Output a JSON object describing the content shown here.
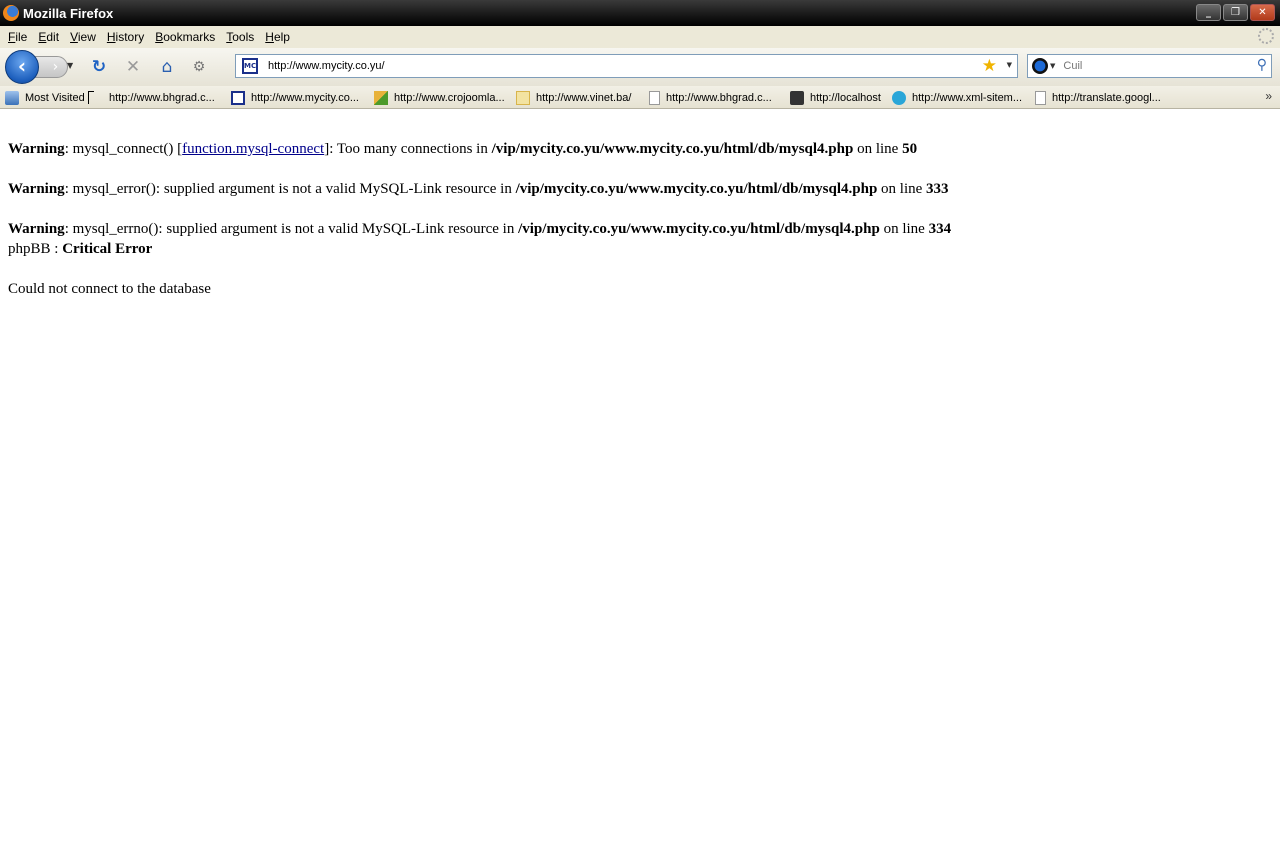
{
  "window": {
    "title": "Mozilla Firefox",
    "buttons": {
      "minimize": "_",
      "restore": "❐",
      "close": "✕"
    }
  },
  "menubar": {
    "items": [
      {
        "label": "File",
        "key": "F",
        "rest": "ile"
      },
      {
        "label": "Edit",
        "key": "E",
        "rest": "dit"
      },
      {
        "label": "View",
        "key": "V",
        "rest": "iew"
      },
      {
        "label": "History",
        "key": "H",
        "rest": "istory"
      },
      {
        "label": "Bookmarks",
        "key": "B",
        "rest": "ookmarks"
      },
      {
        "label": "Tools",
        "key": "T",
        "rest": "ools"
      },
      {
        "label": "Help",
        "key": "H",
        "rest": "elp"
      }
    ]
  },
  "navbar": {
    "url": "http://www.mycity.co.yu/",
    "site_icon_text": "MC",
    "search_placeholder": "Cuil"
  },
  "bookmarks": {
    "items": [
      {
        "label": "Most Visited",
        "icon": "most-visited-icon"
      },
      {
        "label": "http://www.bhgrad.c...",
        "icon": "page-icon"
      },
      {
        "label": "http://www.mycity.co...",
        "icon": "mycity-icon"
      },
      {
        "label": "http://www.crojoomla...",
        "icon": "crojoomla-icon"
      },
      {
        "label": "http://www.vinet.ba/",
        "icon": "vinet-icon"
      },
      {
        "label": "http://www.bhgrad.c...",
        "icon": "page-icon"
      },
      {
        "label": "http://localhost",
        "icon": "localhost-icon"
      },
      {
        "label": "http://www.xml-sitem...",
        "icon": "xml-sitemap-icon"
      },
      {
        "label": "http://translate.googl...",
        "icon": "page-icon"
      }
    ]
  },
  "content": {
    "warning_label": "Warning",
    "w1": {
      "pre": ": mysql_connect() [",
      "link": "function.mysql-connect",
      "mid": "]: Too many connections in ",
      "path": "/vip/mycity.co.yu/www.mycity.co.yu/html/db/mysql4.php",
      "online": " on line ",
      "line": "50"
    },
    "w2": {
      "pre": ": mysql_error(): supplied argument is not a valid MySQL-Link resource in ",
      "path": "/vip/mycity.co.yu/www.mycity.co.yu/html/db/mysql4.php",
      "online": " on line ",
      "line": "333"
    },
    "w3": {
      "pre": ": mysql_errno(): supplied argument is not a valid MySQL-Link resource in ",
      "path": "/vip/mycity.co.yu/www.mycity.co.yu/html/db/mysql4.php",
      "online": " on line ",
      "line": "334"
    },
    "critical_prefix": "phpBB : ",
    "critical_title": "Critical Error",
    "message": "Could not connect to the database"
  }
}
